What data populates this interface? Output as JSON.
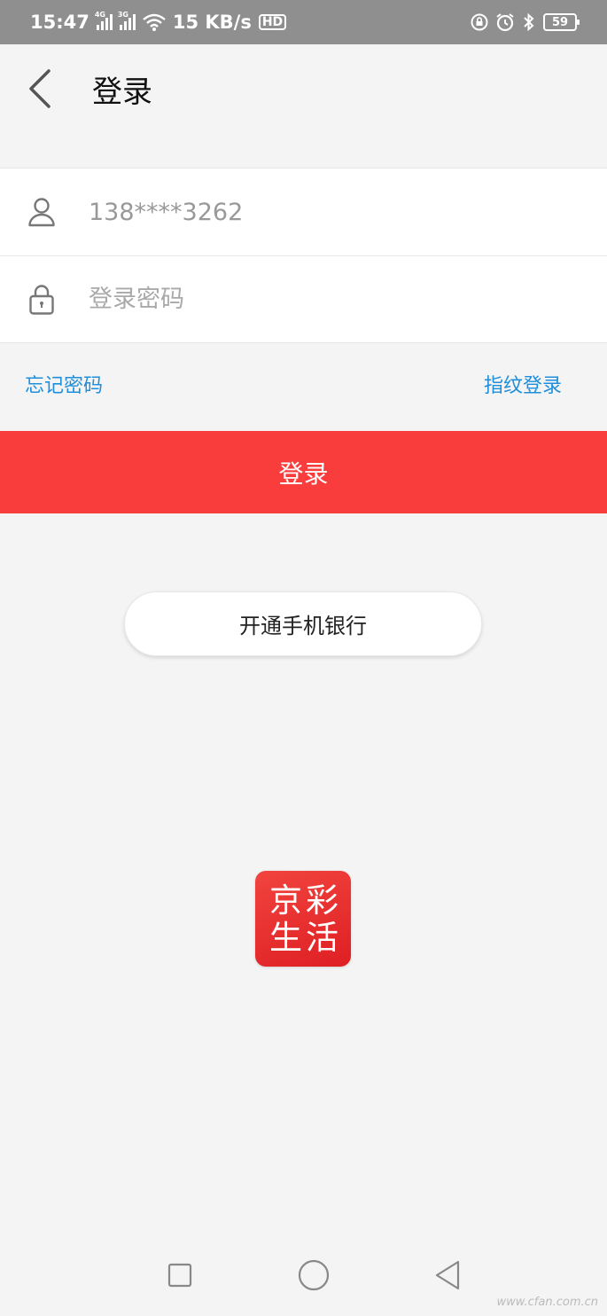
{
  "status_bar": {
    "time": "15:47",
    "sim1_tag": "4G",
    "sim2_tag": "3G",
    "speed": "15 KB/s",
    "hd_label": "HD",
    "battery": "59"
  },
  "header": {
    "title": "登录",
    "back_icon": "chevron-left-icon"
  },
  "form": {
    "account_value": "138****3262",
    "account_icon": "user-icon",
    "password_placeholder": "登录密码",
    "password_icon": "lock-icon"
  },
  "links": {
    "forgot_password": "忘记密码",
    "fingerprint_login": "指纹登录"
  },
  "login_button": "登录",
  "open_mobile_banking_button": "开通手机银行",
  "logo": {
    "chars": [
      "京",
      "彩",
      "生",
      "活"
    ]
  },
  "colors": {
    "accent_red": "#f93c3c",
    "link_blue": "#1f8fdb",
    "status_bar_gray": "#8f8f8f"
  },
  "watermark": "www.cfan.com.cn"
}
